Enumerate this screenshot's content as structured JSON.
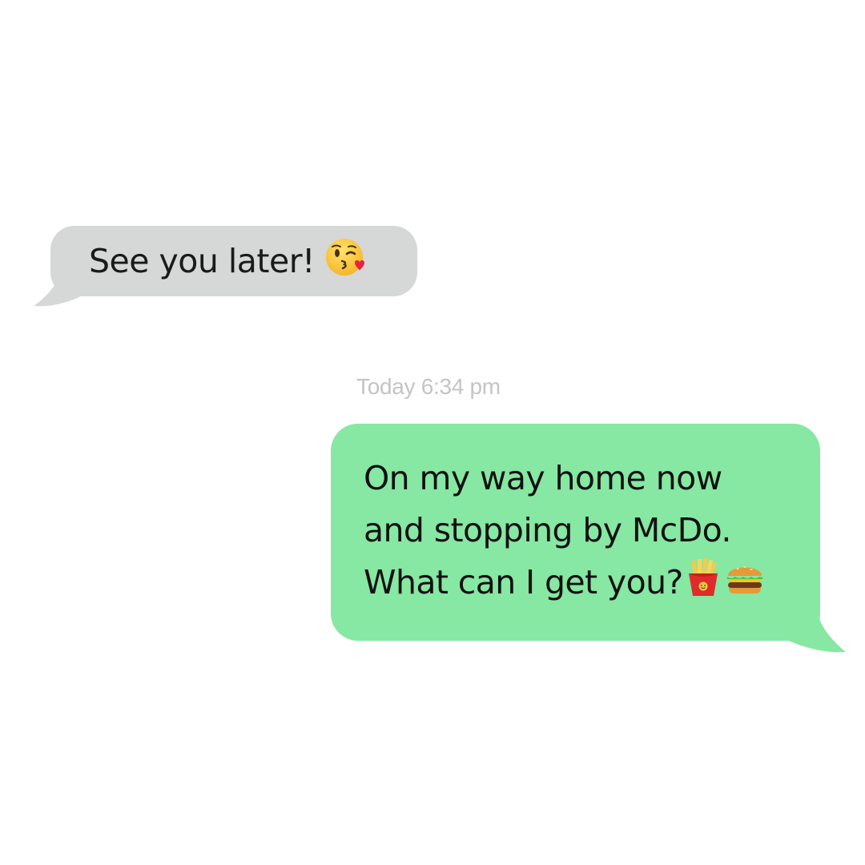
{
  "conversation": {
    "incoming": {
      "text": "See you later!",
      "emoji": "kissing-face-with-heart"
    },
    "timestamp": "Today 6:34 pm",
    "outgoing": {
      "lines": [
        "On my way home now",
        "and stopping by McDo.",
        "What can I get you?"
      ],
      "emojis": [
        "french-fries",
        "hamburger"
      ]
    }
  },
  "colors": {
    "incoming_bubble": "#d6d7d7",
    "outgoing_bubble": "#86e8a2",
    "timestamp_text": "#c4c4c4",
    "background": "#ffffff"
  }
}
